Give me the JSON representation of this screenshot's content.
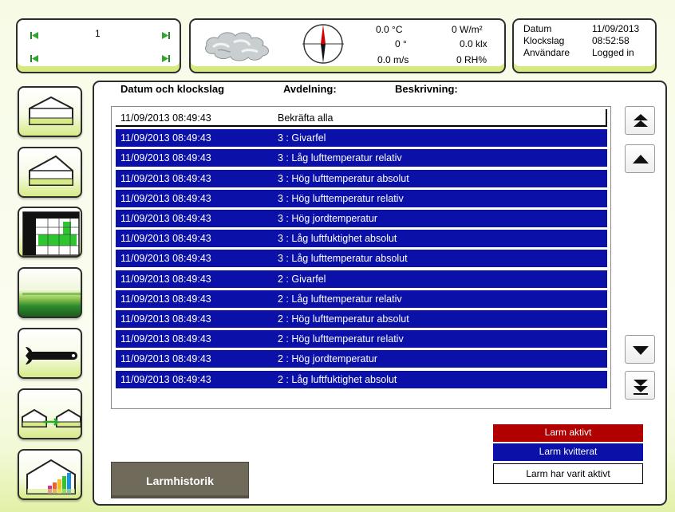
{
  "nav": {
    "counter": "1"
  },
  "weather": {
    "temperature": "0.0 °C",
    "wind_direction": "0 °",
    "wind_speed": "0.0 m/s",
    "radiation": "0 W/m²",
    "light": "0.0 klx",
    "humidity": "0 RH%"
  },
  "info": {
    "date_label": "Datum",
    "date_value": "11/09/2013",
    "time_label": "Klockslag",
    "time_value": "08:52:58",
    "user_label": "Användare",
    "user_value": "Logged in"
  },
  "columns": {
    "datetime": "Datum och klockslag",
    "section": "Avdelning:",
    "description": "Beskrivning:"
  },
  "alarms": [
    {
      "time": "11/09/2013 08:49:43",
      "text": "Bekräfta alla",
      "state": "aktiv"
    },
    {
      "time": "11/09/2013 08:49:43",
      "text": "3 : Givarfel",
      "state": "kvit"
    },
    {
      "time": "11/09/2013 08:49:43",
      "text": "3 : Låg lufttemperatur relativ",
      "state": "kvit"
    },
    {
      "time": "11/09/2013 08:49:43",
      "text": "3 : Hög lufttemperatur absolut",
      "state": "kvit"
    },
    {
      "time": "11/09/2013 08:49:43",
      "text": "3 : Hög lufttemperatur relativ",
      "state": "kvit"
    },
    {
      "time": "11/09/2013 08:49:43",
      "text": "3 : Hög jordtemperatur",
      "state": "kvit"
    },
    {
      "time": "11/09/2013 08:49:43",
      "text": "3 : Låg luftfuktighet absolut",
      "state": "kvit"
    },
    {
      "time": "11/09/2013 08:49:43",
      "text": "3 : Låg lufttemperatur absolut",
      "state": "kvit"
    },
    {
      "time": "11/09/2013 08:49:43",
      "text": "2 : Givarfel",
      "state": "kvit"
    },
    {
      "time": "11/09/2013 08:49:43",
      "text": "2 : Låg lufttemperatur relativ",
      "state": "kvit"
    },
    {
      "time": "11/09/2013 08:49:43",
      "text": "2 : Hög lufttemperatur absolut",
      "state": "kvit"
    },
    {
      "time": "11/09/2013 08:49:43",
      "text": "2 : Hög lufttemperatur relativ",
      "state": "kvit"
    },
    {
      "time": "11/09/2013 08:49:43",
      "text": "2 : Hög jordtemperatur",
      "state": "kvit"
    },
    {
      "time": "11/09/2013 08:49:43",
      "text": "2 : Låg luftfuktighet absolut",
      "state": "kvit"
    }
  ],
  "legend": {
    "active": "Larm aktivt",
    "acknowledged": "Larm kvitterat",
    "was_active": "Larm har varit aktivt"
  },
  "colors": {
    "active": "#b00000",
    "acknowledged": "#0a10a8",
    "was_active": "#ffffff",
    "accent": "#d4ea7f"
  },
  "history_button": "Larmhistorik",
  "icons": [
    "skip-first-icon",
    "skip-last-icon",
    "weather-cloud-icon",
    "wind-compass-icon",
    "greenhouse-icon",
    "greenhouse-alt-icon",
    "climate-chart-icon",
    "field-icon",
    "wrench-icon",
    "greenhouse-transfer-icon",
    "greenhouse-stats-icon",
    "scroll-top-icon",
    "scroll-up-icon",
    "scroll-down-icon",
    "scroll-bottom-icon"
  ]
}
